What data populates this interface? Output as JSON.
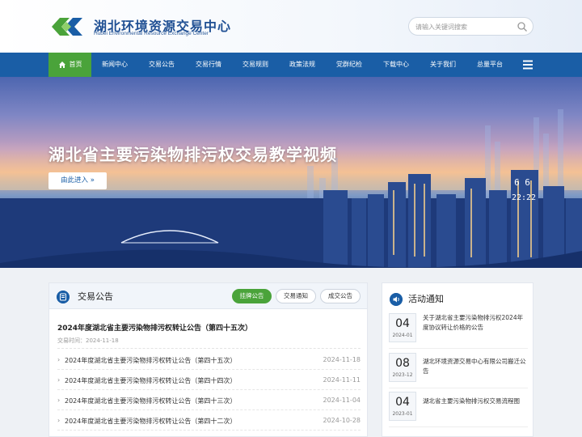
{
  "header": {
    "logo_cn": "湖北环境资源交易中心",
    "logo_en": "Hubei Environmental Resource Exchange Center",
    "search_placeholder": "请输入关键词搜索"
  },
  "nav": {
    "items": [
      "首页",
      "新闻中心",
      "交易公告",
      "交易行情",
      "交易规则",
      "政策法规",
      "党群纪检",
      "下载中心",
      "关于我们",
      "总量平台"
    ]
  },
  "banner": {
    "title": "湖北省主要污染物排污权交易教学视频",
    "button": "由此进入 »",
    "screen_numbers": [
      "6 6",
      "22:22"
    ]
  },
  "announcements": {
    "title": "交易公告",
    "tabs": [
      "挂牌公告",
      "交易通知",
      "成交公告"
    ],
    "featured": {
      "title": "2024年度湖北省主要污染物排污权转让公告（第四十五次）",
      "date": "交易时间：2024-11-18"
    },
    "rows": [
      {
        "title": "2024年度湖北省主要污染物排污权转让公告（第四十五次）",
        "date": "2024-11-18"
      },
      {
        "title": "2024年度湖北省主要污染物排污权转让公告（第四十四次）",
        "date": "2024-11-11"
      },
      {
        "title": "2024年度湖北省主要污染物排污权转让公告（第四十三次）",
        "date": "2024-11-04"
      },
      {
        "title": "2024年度湖北省主要污染物排污权转让公告（第四十二次）",
        "date": "2024-10-28"
      }
    ]
  },
  "activities": {
    "title": "活动通知",
    "items": [
      {
        "day": "04",
        "ym": "2024-01",
        "title": "关于湖北省主要污染物排污权2024年度协议转让价格的公告"
      },
      {
        "day": "08",
        "ym": "2023-12",
        "title": "湖北环境资源交易中心有限公司搬迁公告"
      },
      {
        "day": "04",
        "ym": "2023-01",
        "title": "湖北省主要污染物排污权交易流程图"
      }
    ]
  },
  "colors": {
    "primary_blue": "#1a5ea6",
    "accent_green": "#4aa33a"
  }
}
